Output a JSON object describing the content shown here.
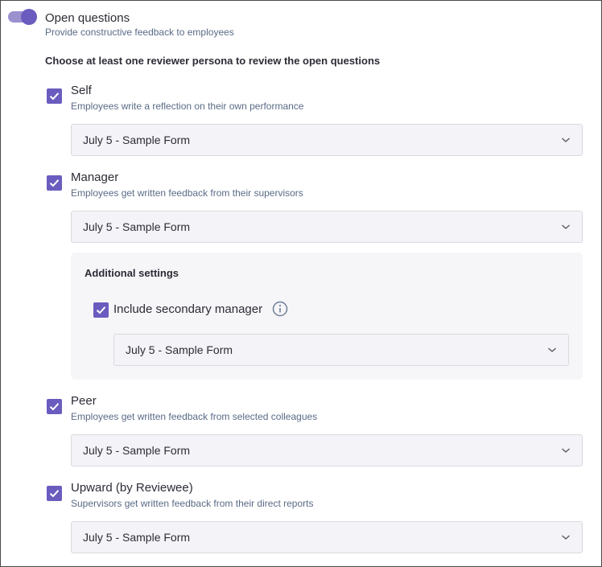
{
  "open_questions": {
    "title": "Open questions",
    "subtitle": "Provide constructive feedback to employees",
    "enabled": true
  },
  "instruction": "Choose at least one reviewer persona to review the open questions",
  "personas": [
    {
      "label": "Self",
      "description": "Employees write a reflection on their own performance",
      "checked": true,
      "form": "July 5 - Sample Form"
    },
    {
      "label": "Manager",
      "description": "Employees get written feedback from their supervisors",
      "checked": true,
      "form": "July 5 - Sample Form"
    },
    {
      "label": "Peer",
      "description": "Employees get written feedback from selected colleagues",
      "checked": true,
      "form": "July 5 - Sample Form"
    },
    {
      "label": "Upward (by Reviewee)",
      "description": "Supervisors get written feedback from their direct reports",
      "checked": true,
      "form": "July 5 - Sample Form"
    }
  ],
  "additional_settings": {
    "title": "Additional settings",
    "secondary_manager_label": "Include secondary manager",
    "secondary_manager_checked": true,
    "secondary_manager_form": "July 5 - Sample Form"
  },
  "colors": {
    "accent": "#6a5cbf",
    "toggle_track": "#9b91cf",
    "description_text": "#5a6b86"
  },
  "icons": {
    "checkbox": "checkmark-icon",
    "dropdown": "chevron-down-icon",
    "info": "info-icon"
  }
}
